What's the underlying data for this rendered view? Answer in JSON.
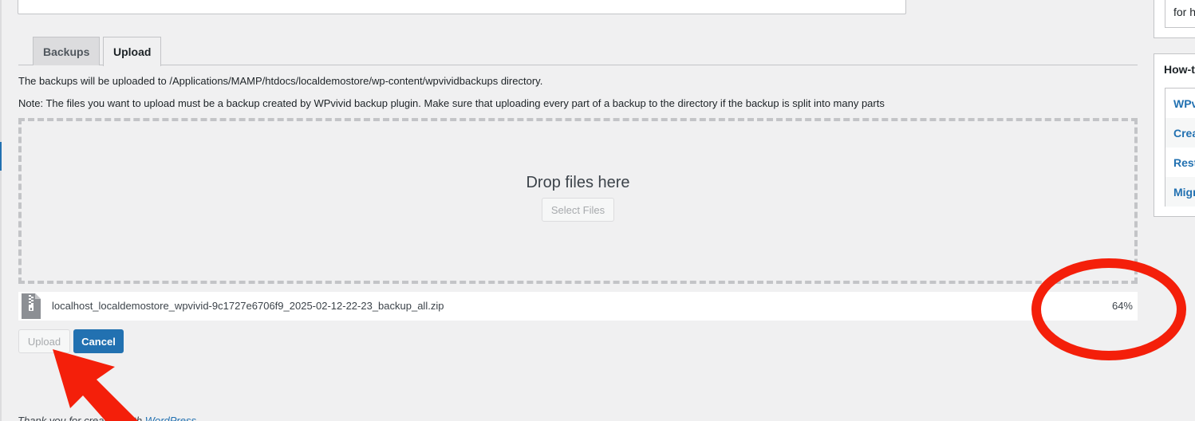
{
  "tabs": [
    {
      "label": "Backups",
      "active": false
    },
    {
      "label": "Upload",
      "active": true
    }
  ],
  "upload": {
    "directory_text": "The backups will be uploaded to /Applications/MAMP/htdocs/localdemostore/wp-content/wpvividbackups directory.",
    "note_text": "Note: The files you want to upload must be a backup created by WPvivid backup plugin. Make sure that uploading every part of a backup to the directory if the backup is split into many parts",
    "drop_title": "Drop files here",
    "select_files_label": "Select Files",
    "file": {
      "icon": "zip-file-icon",
      "name": "localhost_localdemostore_wpvivid-9c1727e6706f9_2025-02-12-22-23_backup_all.zip",
      "progress": "64%"
    },
    "upload_button": "Upload",
    "cancel_button": "Cancel"
  },
  "footer": {
    "prefix": "Thank you for creating with ",
    "link": "WordPress"
  },
  "sidebar": {
    "top_text": "for h",
    "howto_title": "How-t",
    "howto_items": [
      "WPv",
      "Crea",
      "Rest",
      "Migr"
    ]
  },
  "annotations": {
    "color": "#f41f0a",
    "circle_target": "progress-percentage",
    "arrow_target": "upload-button"
  },
  "colors": {
    "accent": "#2271b1",
    "background": "#f0f0f1"
  }
}
